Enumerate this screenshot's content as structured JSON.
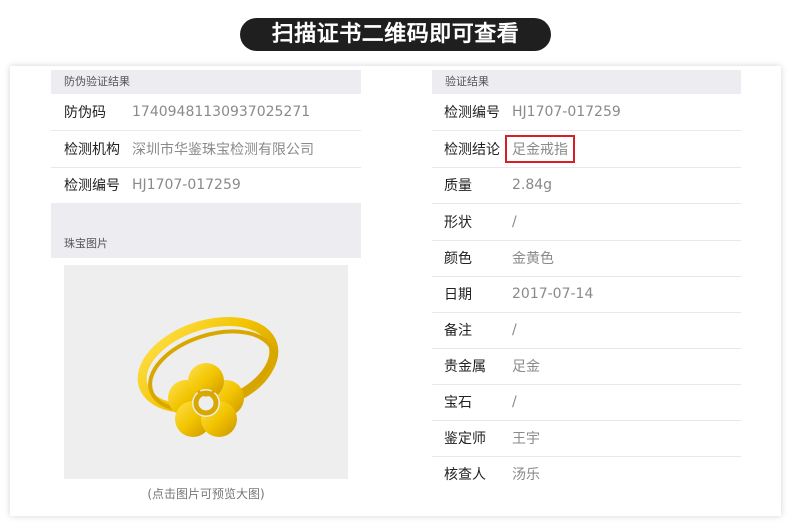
{
  "banner": {
    "title": "扫描证书二维码即可查看"
  },
  "left": {
    "section_title": "防伪验证结果",
    "rows": [
      {
        "label": "防伪码",
        "value": "17409481130937025271"
      },
      {
        "label": "检测机构",
        "value": "深圳市华鉴珠宝检测有限公司"
      },
      {
        "label": "检测编号",
        "value": "HJ1707-017259"
      }
    ],
    "photo_section_title": "珠宝图片",
    "photo_caption": "(点击图片可预览大图)"
  },
  "right": {
    "section_title": "验证结果",
    "rows": [
      {
        "label": "检测编号",
        "value": "HJ1707-017259"
      },
      {
        "label": "检测结论",
        "value": "足金戒指"
      },
      {
        "label": "质量",
        "value": "2.84g"
      },
      {
        "label": "形状",
        "value": "/"
      },
      {
        "label": "颜色",
        "value": "金黄色"
      },
      {
        "label": "日期",
        "value": "2017-07-14"
      },
      {
        "label": "备注",
        "value": "/"
      },
      {
        "label": "贵金属",
        "value": "足金"
      },
      {
        "label": "宝石",
        "value": "/"
      },
      {
        "label": "鉴定师",
        "value": "王宇"
      },
      {
        "label": "核查人",
        "value": "汤乐"
      }
    ]
  },
  "colors": {
    "highlight_border": "#d61f26",
    "gold": "#f2c400"
  }
}
